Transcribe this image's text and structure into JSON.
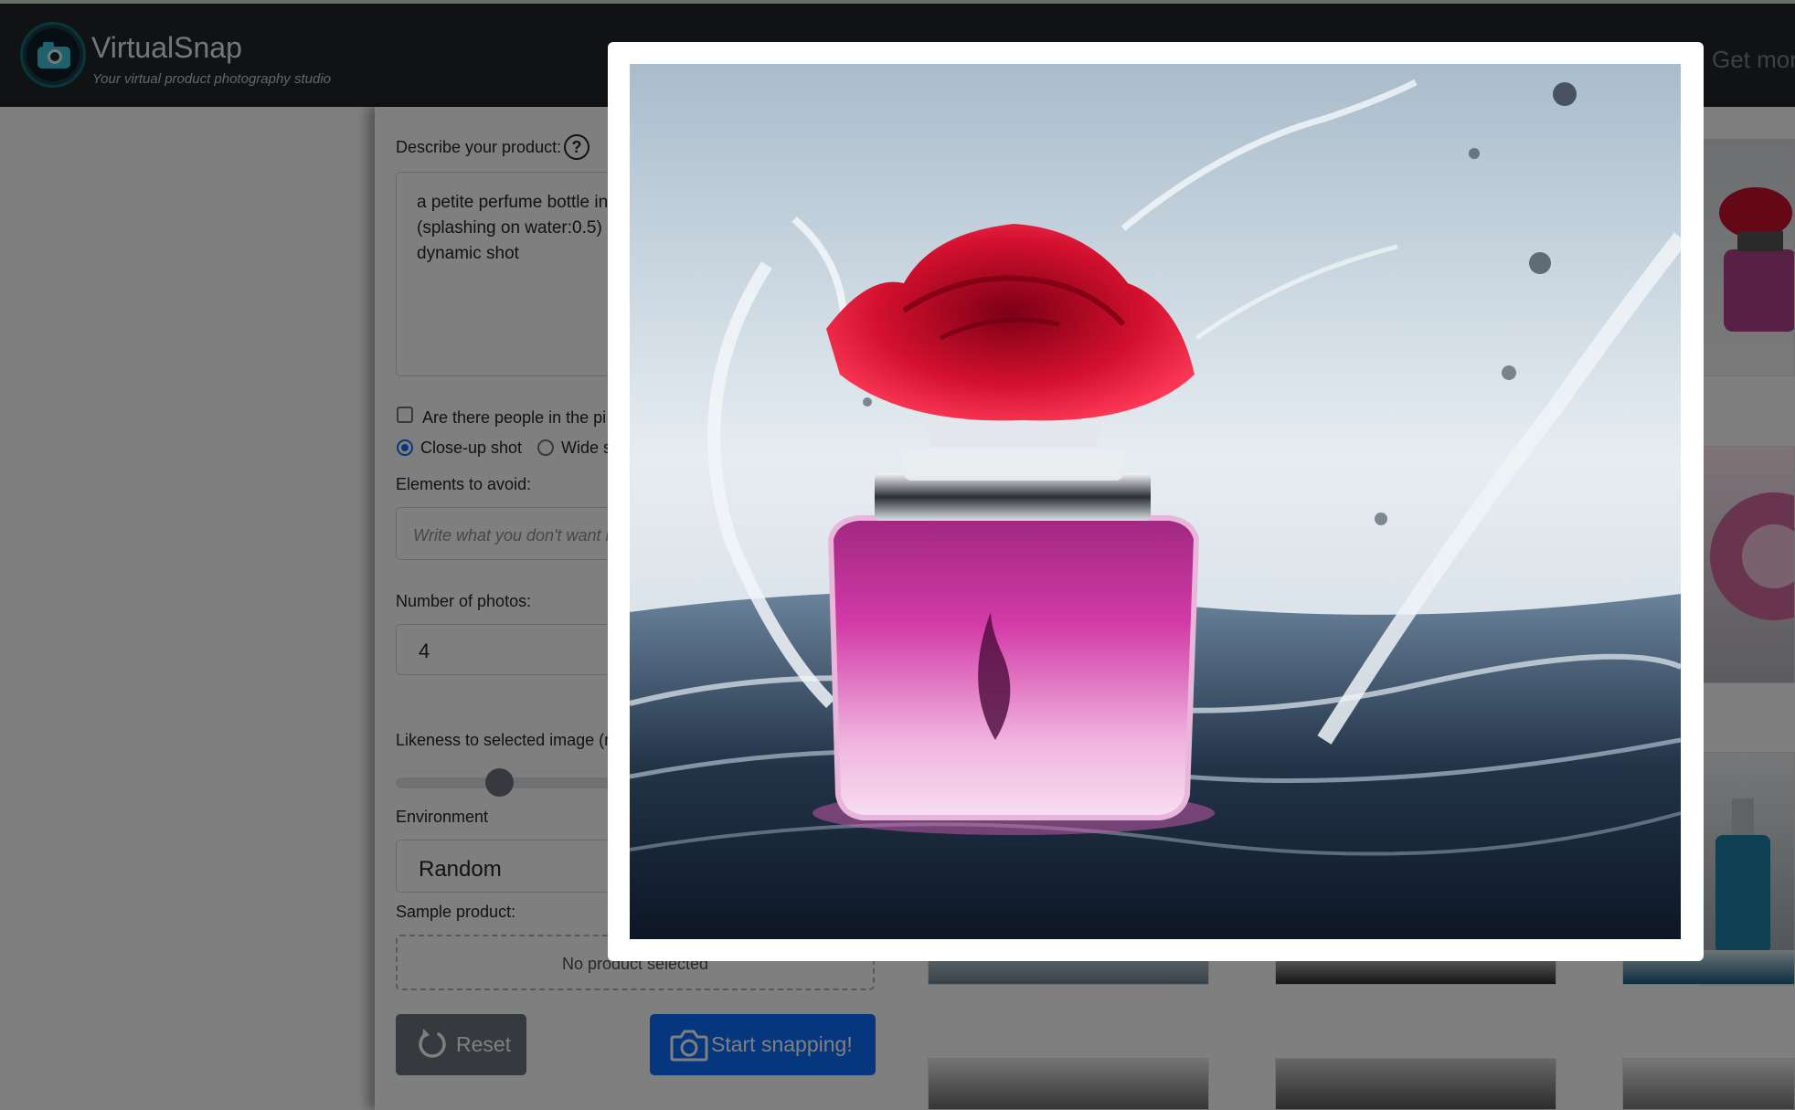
{
  "header": {
    "brand": "VirtualSnap",
    "tagline": "Your virtual product photography studio",
    "nav_link": "Get more"
  },
  "form": {
    "describe_label": "Describe your product:",
    "help_glyph": "?",
    "description_value": "a petite perfume bottle in\n(splashing on water:0.5)\ndynamic shot",
    "people_checkbox_label": "Are there people in the pi",
    "people_checked": false,
    "shot_options": [
      "Close-up shot",
      "Wide s"
    ],
    "shot_selected": "Close-up shot",
    "avoid_label": "Elements to avoid:",
    "avoid_placeholder": "Write what you don't want i",
    "count_label": "Number of photos:",
    "count_value": "4",
    "likeness_label": "Likeness to selected image (m",
    "environment_label": "Environment",
    "environment_value": "Random",
    "sample_label": "Sample product:",
    "sample_value": "No product selected",
    "reset_label": "Reset",
    "snap_label": "Start snapping!"
  },
  "icons": {
    "logo": "camera-logo-icon",
    "help": "question-circle-icon",
    "reset": "rotate-ccw-icon",
    "snap": "camera-icon"
  },
  "colors": {
    "header_bg": "#212529",
    "primary": "#0d6efd",
    "secondary": "#6c757d"
  }
}
